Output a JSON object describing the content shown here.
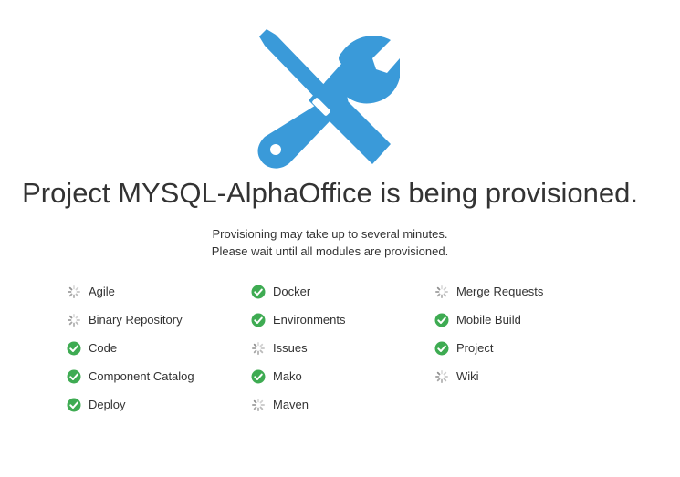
{
  "header": {
    "icon": "tools-icon",
    "title": "Project MYSQL-AlphaOffice is being provisioned.",
    "subtitle_line1": "Provisioning may take up to several minutes.",
    "subtitle_line2": "Please wait until all modules are provisioned."
  },
  "colors": {
    "accent": "#3a9ad9",
    "success": "#3eab52",
    "spinner": "#8a8a8a",
    "text": "#333333"
  },
  "modules": {
    "columns": [
      [
        {
          "label": "Agile",
          "status": "loading"
        },
        {
          "label": "Binary Repository",
          "status": "loading"
        },
        {
          "label": "Code",
          "status": "done"
        },
        {
          "label": "Component Catalog",
          "status": "done"
        },
        {
          "label": "Deploy",
          "status": "done"
        }
      ],
      [
        {
          "label": "Docker",
          "status": "done"
        },
        {
          "label": "Environments",
          "status": "done"
        },
        {
          "label": "Issues",
          "status": "loading"
        },
        {
          "label": "Mako",
          "status": "done"
        },
        {
          "label": "Maven",
          "status": "loading"
        }
      ],
      [
        {
          "label": "Merge Requests",
          "status": "loading"
        },
        {
          "label": "Mobile Build",
          "status": "done"
        },
        {
          "label": "Project",
          "status": "done"
        },
        {
          "label": "Wiki",
          "status": "loading"
        }
      ]
    ]
  }
}
